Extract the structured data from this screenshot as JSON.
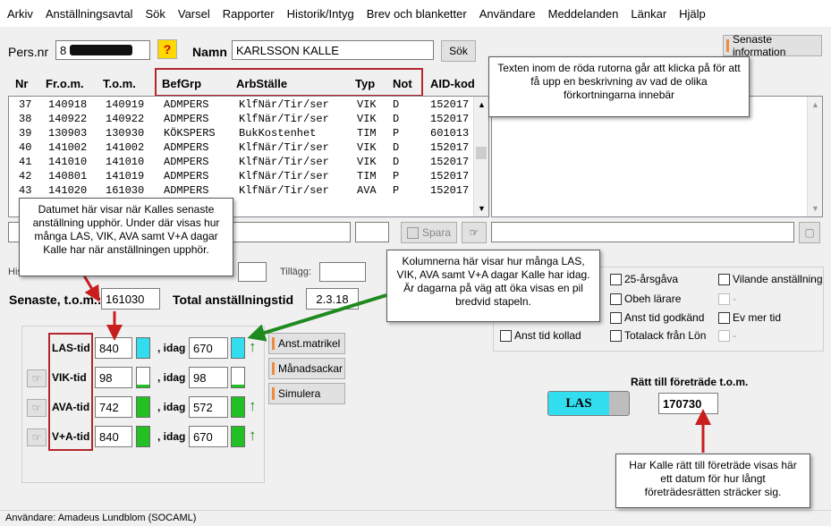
{
  "menu": [
    "Arkiv",
    "Anställningsavtal",
    "Sök",
    "Varsel",
    "Rapporter",
    "Historik/Intyg",
    "Brev och blanketter",
    "Användare",
    "Meddelanden",
    "Länkar",
    "Hjälp"
  ],
  "person": {
    "pnr_label": "Pers.nr",
    "pnr_value": "8",
    "help_label": "?",
    "name_label": "Namn",
    "name_value": "KARLSSON KALLE",
    "search_label": "Sök"
  },
  "latest_info_label": "Senaste information",
  "table": {
    "headers": [
      "Nr",
      "Fr.o.m.",
      "T.o.m.",
      "BefGrp",
      "ArbStälle",
      "Typ",
      "Not",
      "AID-kod"
    ],
    "rows": [
      [
        "37",
        "140918",
        "140919",
        "ADMPERS",
        "KlfNär/Tir/ser",
        "VIK",
        "D",
        "152017"
      ],
      [
        "38",
        "140922",
        "140922",
        "ADMPERS",
        "KlfNär/Tir/ser",
        "VIK",
        "D",
        "152017"
      ],
      [
        "39",
        "130903",
        "130930",
        "KÖKSPERS",
        "BukKostenhet",
        "TIM",
        "P",
        "601013"
      ],
      [
        "40",
        "141002",
        "141002",
        "ADMPERS",
        "KlfNär/Tir/ser",
        "VIK",
        "D",
        "152017"
      ],
      [
        "41",
        "141010",
        "141010",
        "ADMPERS",
        "KlfNär/Tir/ser",
        "VIK",
        "D",
        "152017"
      ],
      [
        "42",
        "140801",
        "141019",
        "ADMPERS",
        "KlfNär/Tir/ser",
        "TIM",
        "P",
        "152017"
      ],
      [
        "43",
        "141020",
        "161030",
        "ADMPERS",
        "KlfNär/Tir/ser",
        "AVA",
        "P",
        "152017"
      ]
    ]
  },
  "save_label": "Spara",
  "history": {
    "his_label": "His",
    "tillagg_label": "Tillägg:"
  },
  "latest": {
    "label": "Senaste, t.o.m.:",
    "value": "161030",
    "total_label": "Total anställningstid",
    "total_value": "2.3.18"
  },
  "tid": [
    {
      "label": "LAS-tid",
      "value": "840",
      "idag_label": ", idag",
      "idag": "670",
      "fill": 1.0,
      "fill_color": "#33ddf0",
      "arrow": true,
      "hand": false
    },
    {
      "label": "VIK-tid",
      "value": "98",
      "idag_label": ", idag",
      "idag": "98",
      "fill": 0.12,
      "fill_color": "#22c022",
      "arrow": false,
      "hand": true
    },
    {
      "label": "AVA-tid",
      "value": "742",
      "idag_label": ", idag",
      "idag": "572",
      "fill": 1.0,
      "fill_color": "#22c022",
      "arrow": true,
      "hand": true
    },
    {
      "label": "V+A-tid",
      "value": "840",
      "idag_label": ", idag",
      "idag": "670",
      "fill": 1.0,
      "fill_color": "#22c022",
      "arrow": true,
      "hand": true
    }
  ],
  "side_buttons": [
    "Anst.matrikel",
    "Månadsackar",
    "Simulera"
  ],
  "checkboxes": [
    {
      "label": "25-årsgåva"
    },
    {
      "label": "Vilande anställning"
    },
    {
      "label": "Obeh lärare"
    },
    {
      "label": "-"
    },
    {
      "label": "Anst tid godkänd"
    },
    {
      "label": "Ev mer tid"
    },
    {
      "label": "Anst tid kollad"
    },
    {
      "label": "Totalack från Lön"
    },
    {
      "label": "-"
    }
  ],
  "foretrade": {
    "label": "Rätt till företräde t.o.m.",
    "las_label": "LAS",
    "value": "170730"
  },
  "callouts": {
    "red_boxes": "Texten inom de röda rutorna går att klicka på för att få upp en beskrivning av vad de olika förkortningarna innebär",
    "latest_date": "Datumet här visar när Kalles senaste anställning upphör. Under där visas hur många LAS, VIK, AVA samt V+A dagar Kalle har när anställningen upphör.",
    "columns": "Kolumnerna här visar hur många LAS, VIK, AVA samt V+A dagar Kalle har idag. Är dagarna på väg att öka visas en pil bredvid stapeln.",
    "foretrade": "Har Kalle rätt till företräde visas här ett datum för hur långt företrädesrätten sträcker sig."
  },
  "statusbar": "Användare: Amadeus Lundblom (SOCAML)",
  "colors": {
    "red_box": "#b5262e",
    "arrow_red": "#c81e1e",
    "arrow_green": "#1f8a1f",
    "las_blue": "#33ddf0",
    "bar_green": "#22c022"
  }
}
